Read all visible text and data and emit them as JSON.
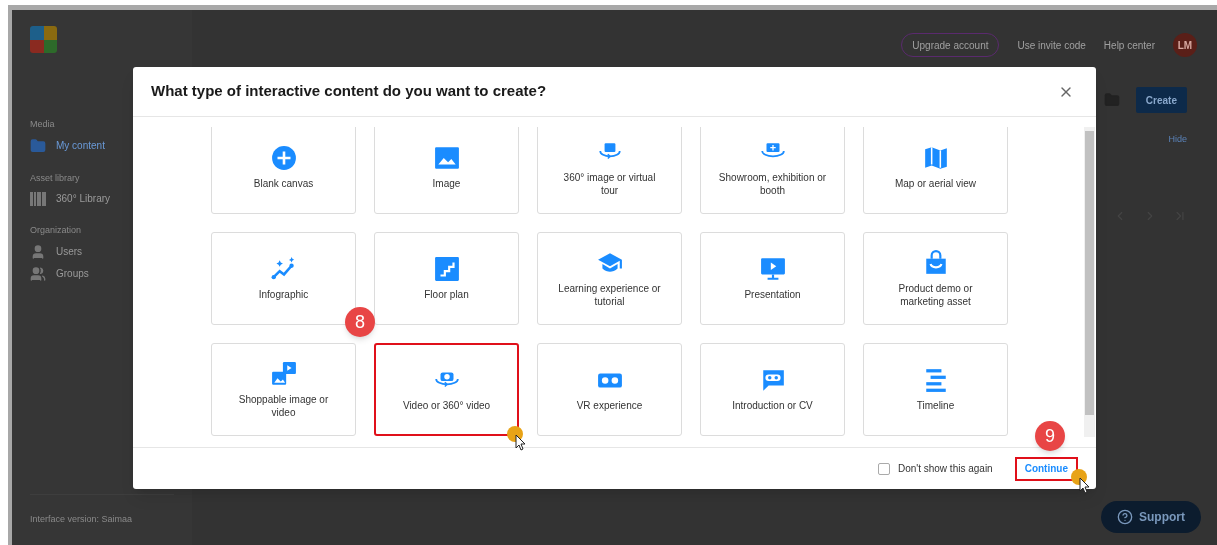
{
  "header": {
    "upgrade": "Upgrade account",
    "links": [
      "Use invite code",
      "Help center"
    ],
    "avatar": "LM"
  },
  "sidebar": {
    "sections": [
      {
        "heading": "Media",
        "items": [
          {
            "label": "My content",
            "kind": "folder",
            "selected": true
          }
        ]
      },
      {
        "heading": "Asset library",
        "items": [
          {
            "label": "360° Library",
            "kind": "library",
            "selected": false
          }
        ]
      },
      {
        "heading": "Organization",
        "items": [
          {
            "label": "Users",
            "kind": "user",
            "selected": false
          },
          {
            "label": "Groups",
            "kind": "users",
            "selected": false
          }
        ]
      }
    ],
    "version": "Interface version: Saimaa"
  },
  "content": {
    "create_button": "Create",
    "hide_link": "Hide"
  },
  "support_button": "Support",
  "dialog": {
    "title": "What type of interactive content do you want to create?",
    "tiles": [
      {
        "label": "Blank canvas",
        "kind": "plus",
        "highlighted": false
      },
      {
        "label": "Image",
        "kind": "image",
        "highlighted": false
      },
      {
        "label": "360° image or virtual tour",
        "kind": "pano",
        "highlighted": false
      },
      {
        "label": "Showroom, exhibition or booth",
        "kind": "showroom",
        "highlighted": false
      },
      {
        "label": "Map or aerial view",
        "kind": "map",
        "highlighted": false
      },
      {
        "label": "Infographic",
        "kind": "chart",
        "highlighted": false
      },
      {
        "label": "Floor plan",
        "kind": "stairs",
        "highlighted": false
      },
      {
        "label": "Learning experience or tutorial",
        "kind": "cap",
        "highlighted": false
      },
      {
        "label": "Presentation",
        "kind": "screen",
        "highlighted": false
      },
      {
        "label": "Product demo or marketing asset",
        "kind": "bag",
        "highlighted": false
      },
      {
        "label": "Shoppable image or video",
        "kind": "media",
        "highlighted": false
      },
      {
        "label": "Video or 360° video",
        "kind": "video360",
        "highlighted": true
      },
      {
        "label": "VR experience",
        "kind": "vr",
        "highlighted": false
      },
      {
        "label": "Introduction or CV",
        "kind": "intro",
        "highlighted": false
      },
      {
        "label": "Timeline",
        "kind": "timeline",
        "highlighted": false
      }
    ],
    "dont_show": {
      "label": "Don't show this again",
      "checked": false
    },
    "continue": {
      "label": "Continue",
      "highlighted": true
    }
  },
  "annotations": [
    {
      "number": "8"
    },
    {
      "number": "9"
    }
  ]
}
